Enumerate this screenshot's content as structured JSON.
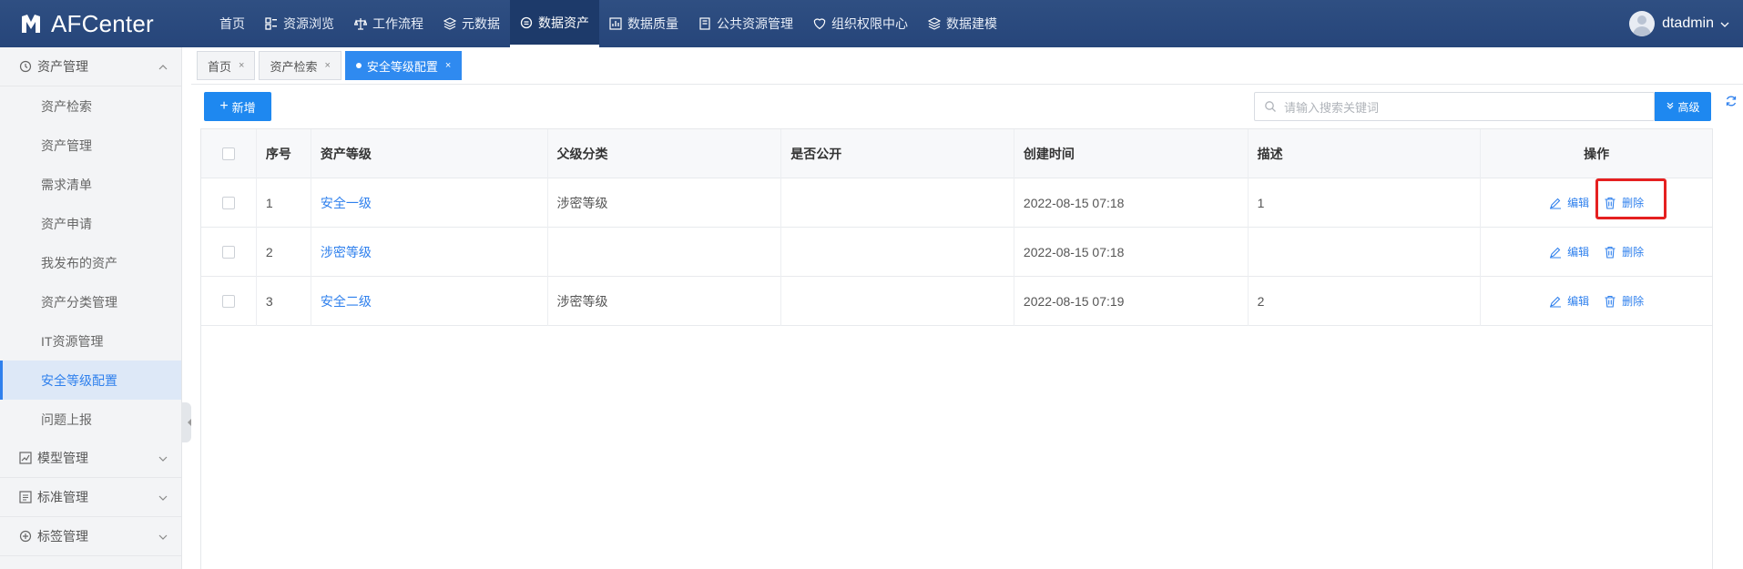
{
  "app": {
    "name": "AFCenter",
    "user": "dtadmin"
  },
  "topnav": [
    {
      "label": "首页",
      "icon": "none"
    },
    {
      "label": "资源浏览",
      "icon": "grid-icon"
    },
    {
      "label": "工作流程",
      "icon": "scale-icon"
    },
    {
      "label": "元数据",
      "icon": "layers-icon"
    },
    {
      "label": "数据资产",
      "icon": "coin-icon",
      "active": true
    },
    {
      "label": "数据质量",
      "icon": "chart-icon"
    },
    {
      "label": "公共资源管理",
      "icon": "doc-icon"
    },
    {
      "label": "组织权限中心",
      "icon": "shield-icon"
    },
    {
      "label": "数据建模",
      "icon": "stack-icon"
    }
  ],
  "sidebar": {
    "groups": [
      {
        "label": "资产管理",
        "expanded": true,
        "items": [
          "资产检索",
          "资产管理",
          "需求清单",
          "资产申请",
          "我发布的资产",
          "资产分类管理",
          "IT资源管理",
          "安全等级配置",
          "问题上报"
        ]
      },
      {
        "label": "模型管理",
        "expanded": false
      },
      {
        "label": "标准管理",
        "expanded": false
      },
      {
        "label": "标签管理",
        "expanded": false
      }
    ],
    "active_item": "安全等级配置"
  },
  "tabs": [
    {
      "label": "首页",
      "close": "×"
    },
    {
      "label": "资产检索",
      "close": "×"
    },
    {
      "label": "安全等级配置",
      "close": "×",
      "active": true
    }
  ],
  "toolbar": {
    "add_label": "新增",
    "search_placeholder": "请输入搜索关键词",
    "advanced_label": "高级"
  },
  "table": {
    "columns": [
      "序号",
      "资产等级",
      "父级分类",
      "是否公开",
      "创建时间",
      "描述",
      "操作"
    ],
    "rows": [
      {
        "no": "1",
        "level": "安全一级",
        "parent": "涉密等级",
        "public": "",
        "created": "2022-08-15 07:18",
        "desc": "1"
      },
      {
        "no": "2",
        "level": "涉密等级",
        "parent": "",
        "public": "",
        "created": "2022-08-15 07:18",
        "desc": ""
      },
      {
        "no": "3",
        "level": "安全二级",
        "parent": "涉密等级",
        "public": "",
        "created": "2022-08-15 07:19",
        "desc": "2"
      }
    ],
    "ops": {
      "edit": "编辑",
      "delete": "删除"
    }
  },
  "colors": {
    "primary": "#1e88f0",
    "nav_bg": "#2f4f82",
    "highlight": "#e52020"
  }
}
